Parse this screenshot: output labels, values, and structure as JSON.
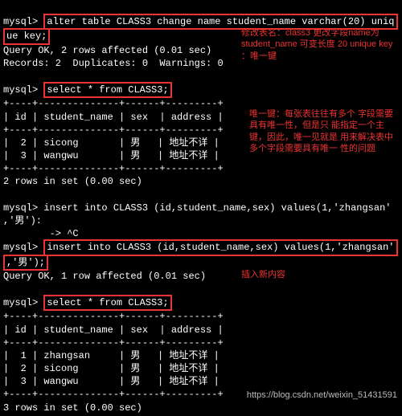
{
  "lines": {
    "l0a": "mysql> ",
    "l0b": "alter table CLASS3 change name student_name varchar(20) uniq",
    "l1": "ue key;",
    "l2": "Query OK, 2 rows affected (0.01 sec)",
    "l3": "Records: 2  Duplicates: 0  Warnings: 0",
    "l4": "",
    "l5a": "mysql> ",
    "l5b": "select * from CLASS3;",
    "hr": "+----+--------------+------+---------+",
    "hd": "| id | student_name | sex  | address |",
    "r1": "|  2 | sicong       | 男   | 地址不详 |",
    "r2": "|  3 | wangwu       | 男   | 地址不详 |",
    "set2": "2 rows in set (0.00 sec)",
    "ins1a": "mysql> insert into CLASS3 (id,student_name,sex) values(1,'zhangsan'",
    "ins1b": ",'男'):",
    "ins1c": "        -> ^C",
    "ins2a": "mysql> ",
    "ins2b": "insert into CLASS3 (id,student_name,sex) values(1,'zhangsan'",
    "ins2c": ",'男');",
    "ok1": "Query OK, 1 row affected (0.01 sec)",
    "l18a": "mysql> ",
    "l18b": "select * from CLASS3;",
    "r3": "|  1 | zhangsan     | 男   | 地址不详 |",
    "r4": "|  2 | sicong       | 男   | 地址不详 |",
    "r5": "|  3 | wangwu       | 男   | 地址不详 |",
    "set3": "3 rows in set (0.00 sec)"
  },
  "notes": {
    "n1": "修改表名：class3 更改字段name为\nstudent_name 可变长度 20 unique\nkey ：唯一键",
    "n2": "唯一键：每张表往往有多个\n字段需要具有唯一性，但是只\n能指定一个主键，因此，唯一见就是\n用来解决表中多个字段需要具有唯一\n性的问题",
    "n3": "插入新内容"
  },
  "footer": "https://blog.csdn.net/weixin_51431591"
}
